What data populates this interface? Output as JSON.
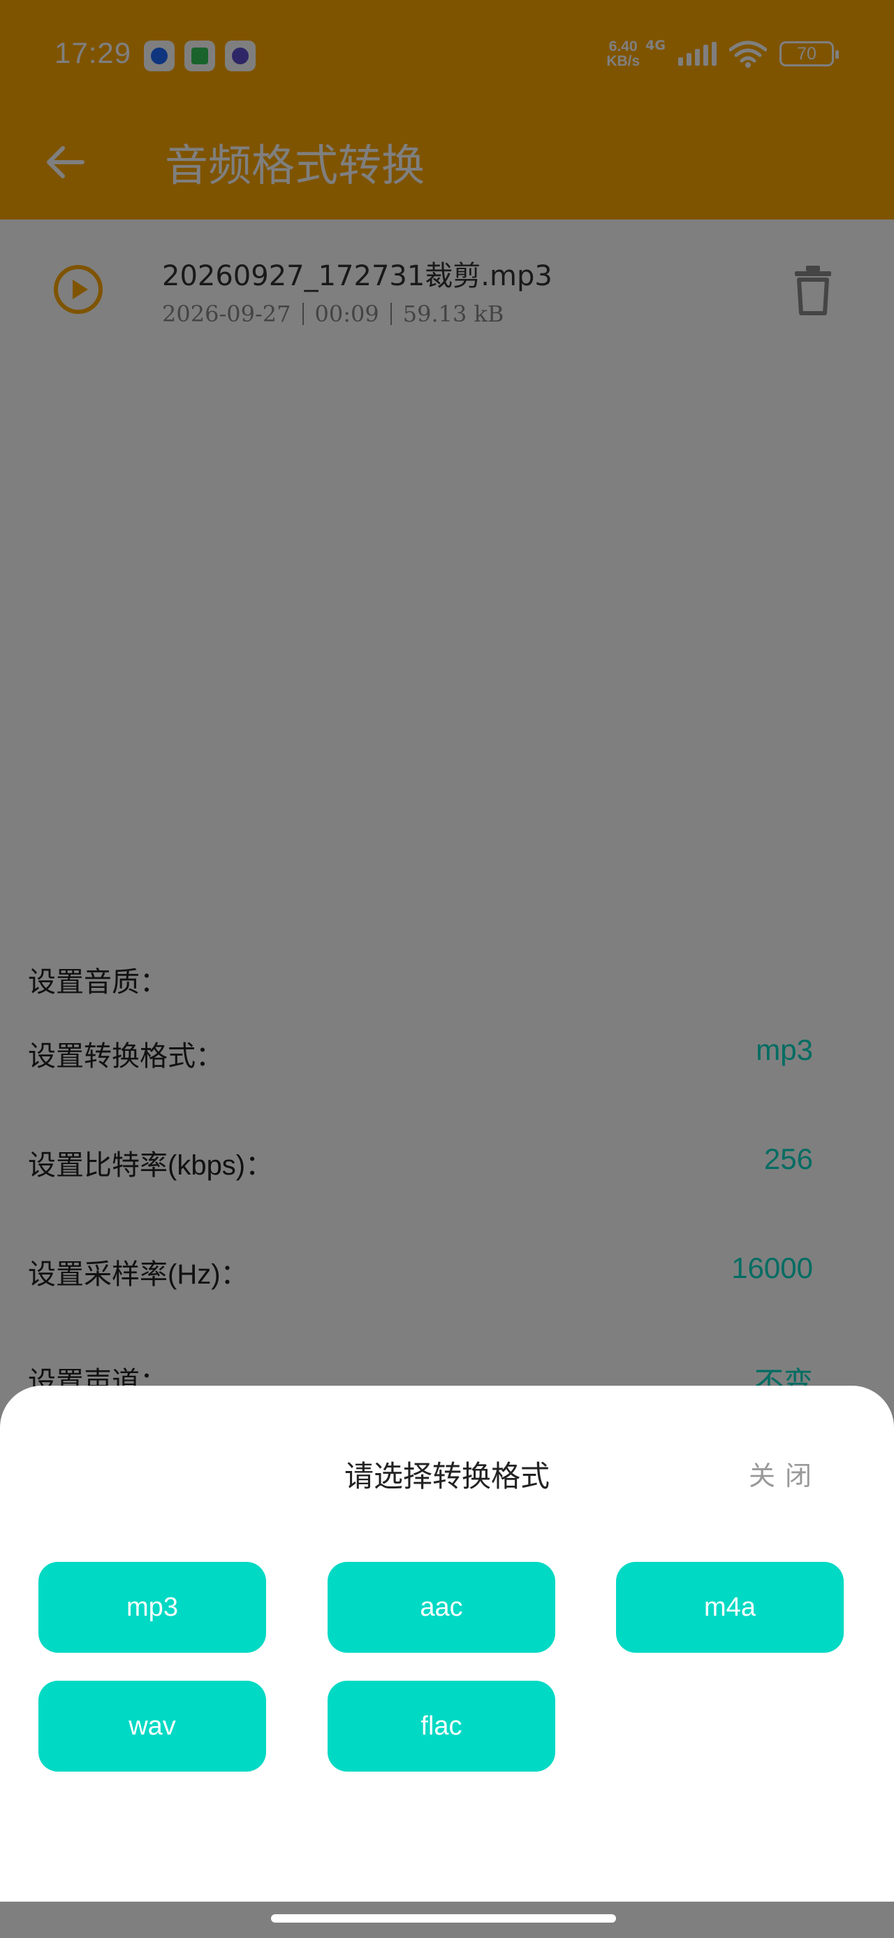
{
  "status_bar": {
    "time": "17:29",
    "net_speed_value": "6.40",
    "net_speed_unit": "KB/s",
    "network_type": "4G",
    "battery": "70",
    "apps": [
      {
        "icon": "blue-app-icon",
        "color": "#1f6bff"
      },
      {
        "icon": "puzzle-app-icon",
        "color": "#34c759"
      },
      {
        "icon": "purple-app-icon",
        "color": "#5b4fcf"
      }
    ]
  },
  "app_bar": {
    "title": "音频格式转换",
    "back_icon": "arrow-left-icon",
    "color": "#fea800"
  },
  "file": {
    "name": "20260927_172731裁剪.mp3",
    "date": "2026-09-27",
    "duration": "00:09",
    "size": "59.13 kB"
  },
  "settings": {
    "section_label": "设置音质：",
    "rows": [
      {
        "label": "设置转换格式：",
        "value": "mp3"
      },
      {
        "label": "设置比特率(kbps)：",
        "value": "256"
      },
      {
        "label": "设置采样率(Hz)：",
        "value": "16000"
      },
      {
        "label": "设置声道：",
        "value": "不变"
      }
    ],
    "value_color": "#00d9c4"
  },
  "sheet": {
    "title": "请选择转换格式",
    "close_label": "关闭",
    "formats": [
      "mp3",
      "aac",
      "m4a",
      "wav",
      "flac"
    ],
    "button_color": "#00d9c4"
  }
}
